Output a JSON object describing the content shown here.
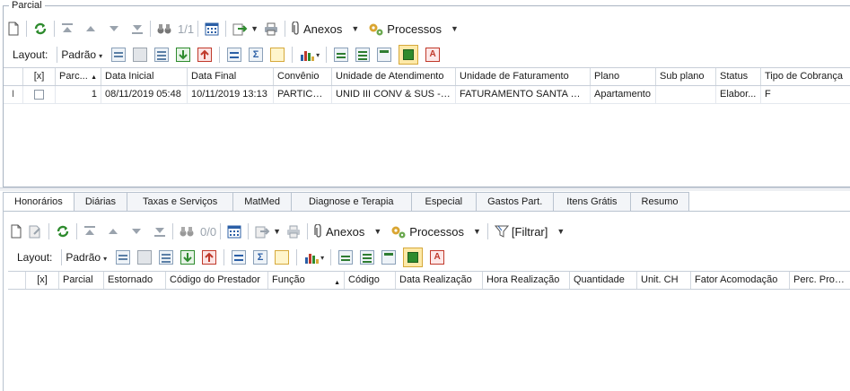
{
  "group_title": "Parcial",
  "toolbar1": {
    "counter": "1/1",
    "anexos": "Anexos",
    "processos": "Processos"
  },
  "layout1": {
    "label": "Layout:",
    "preset": "Padrão"
  },
  "grid1": {
    "columns": [
      "[x]",
      "Parc...",
      "Data Inicial",
      "Data Final",
      "Convênio",
      "Unidade de Atendimento",
      "Unidade de Faturamento",
      "Plano",
      "Sub plano",
      "Status",
      "Tipo de Cobrança"
    ],
    "rows": [
      {
        "parc": "1",
        "data_inicial": "08/11/2019 05:48",
        "data_final": "10/11/2019 13:13",
        "convenio": "PARTICU...",
        "unidade_atendimento": "UNID III CONV & SUS - C...",
        "unidade_faturamento": "FATURAMENTO SANTA CASA",
        "plano": "Apartamento",
        "sub_plano": "",
        "status": "Elabor...",
        "tipo_cobranca": "F",
        "indicator": "I"
      }
    ]
  },
  "tabs": [
    "Honorários",
    "Diárias",
    "Taxas e Serviços",
    "MatMed",
    "Diagnose e Terapia",
    "Especial",
    "Gastos Part.",
    "Itens Grátis",
    "Resumo"
  ],
  "toolbar2": {
    "counter": "0/0",
    "anexos": "Anexos",
    "processos": "Processos",
    "filtrar": "[Filtrar]"
  },
  "layout2": {
    "label": "Layout:",
    "preset": "Padrão"
  },
  "grid2": {
    "columns": [
      "[x]",
      "Parcial",
      "Estornado",
      "Código do Prestador",
      "Função",
      "Código",
      "Data Realização",
      "Hora Realização",
      "Quantidade",
      "Unit. CH",
      "Fator Acomodação",
      "Perc. Profiss"
    ]
  }
}
